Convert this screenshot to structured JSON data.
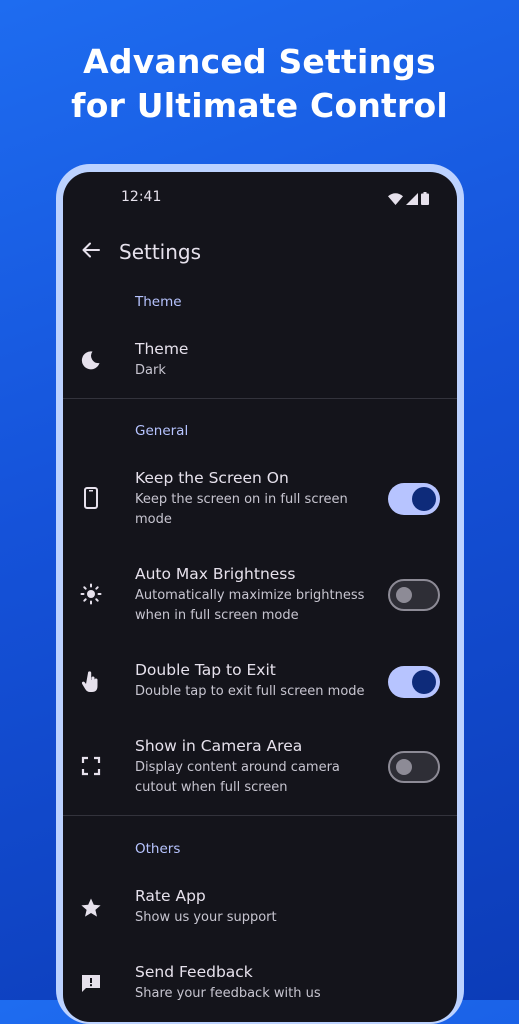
{
  "promo": {
    "line1": "Advanced Settings",
    "line2": "for Ultimate Control"
  },
  "status_bar": {
    "time": "12:41",
    "icons": [
      "wifi-icon",
      "signal-icon",
      "battery-icon"
    ]
  },
  "app_bar": {
    "back_icon": "arrow-back-icon",
    "title": "Settings"
  },
  "sections": {
    "theme": {
      "header": "Theme",
      "items": [
        {
          "icon": "moon-icon",
          "title": "Theme",
          "subtitle": "Dark"
        }
      ]
    },
    "general": {
      "header": "General",
      "items": [
        {
          "icon": "phone-icon",
          "title": "Keep the Screen On",
          "subtitle": "Keep the screen on in full screen mode",
          "toggle": true
        },
        {
          "icon": "brightness-icon",
          "title": "Auto Max Brightness",
          "subtitle": "Automatically maximize brightness when in full screen mode",
          "toggle": false
        },
        {
          "icon": "tap-icon",
          "title": "Double Tap to Exit",
          "subtitle": "Double tap to exit full screen mode",
          "toggle": true
        },
        {
          "icon": "fullscreen-icon",
          "title": "Show in Camera Area",
          "subtitle": "Display content around camera cutout when full screen",
          "toggle": false
        }
      ]
    },
    "others": {
      "header": "Others",
      "items": [
        {
          "icon": "star-icon",
          "title": "Rate App",
          "subtitle": "Show us your support"
        },
        {
          "icon": "feedback-icon",
          "title": "Send Feedback",
          "subtitle": "Share your feedback with us"
        }
      ]
    }
  },
  "colors": {
    "background_top": "#1e6cf0",
    "background_bottom": "#0c3cb8",
    "screen": "#14141b",
    "accent": "#b7c4ff",
    "toggle_knob_on": "#0e2b7a"
  }
}
